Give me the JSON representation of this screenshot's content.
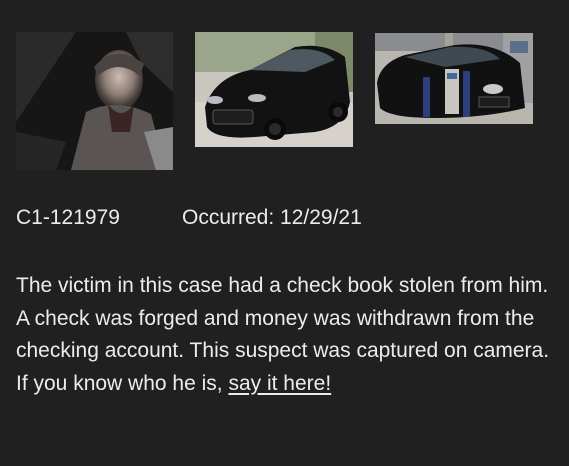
{
  "photos": [
    {
      "name": "suspect-photo",
      "alt": "Suspect in vehicle"
    },
    {
      "name": "vehicle-photo-front",
      "alt": "Black sedan front view"
    },
    {
      "name": "vehicle-photo-atm",
      "alt": "Black sedan at drive-through"
    }
  ],
  "case": {
    "id": "C1-121979",
    "occurred_label": "Occurred:",
    "occurred_date": "12/29/21"
  },
  "description": {
    "text": "The victim in this case had a check book stolen from him. A check was forged and money was withdrawn from the checking account. This suspect was captured on camera. If you know who he is, ",
    "link_text": "say it here!"
  }
}
